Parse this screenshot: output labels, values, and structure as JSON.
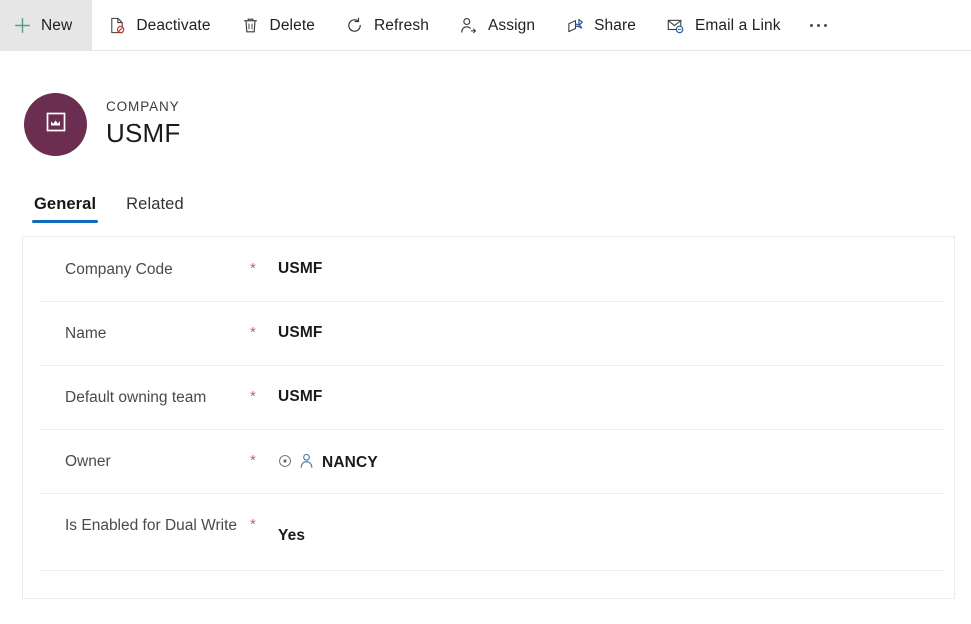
{
  "commandbar": {
    "buttons": [
      {
        "label": "New",
        "icon": "plus-icon",
        "state": "active"
      },
      {
        "label": "Deactivate",
        "icon": "deactivate-icon",
        "state": "default"
      },
      {
        "label": "Delete",
        "icon": "trash-icon",
        "state": "default"
      },
      {
        "label": "Refresh",
        "icon": "refresh-icon",
        "state": "default"
      },
      {
        "label": "Assign",
        "icon": "assign-user-icon",
        "state": "default"
      },
      {
        "label": "Share",
        "icon": "share-icon",
        "state": "default"
      },
      {
        "label": "Email a Link",
        "icon": "email-link-icon",
        "state": "default"
      }
    ],
    "overflow_icon": "ellipsis-icon"
  },
  "record_header": {
    "entity_label": "COMPANY",
    "title": "USMF",
    "avatar_icon": "company-icon",
    "avatar_color": "#6B2E50"
  },
  "tabs": [
    {
      "label": "General",
      "selected": true
    },
    {
      "label": "Related",
      "selected": false
    }
  ],
  "form": {
    "fields": [
      {
        "label": "Company Code",
        "required": "*",
        "value": "USMF"
      },
      {
        "label": "Name",
        "required": "*",
        "value": "USMF"
      },
      {
        "label": "Default owning team",
        "required": "*",
        "value": "USMF"
      },
      {
        "label": "Owner",
        "required": "*",
        "value": "NANCY",
        "icons": [
          "recent-record-icon",
          "person-icon"
        ]
      },
      {
        "label": "Is Enabled for Dual Write",
        "required": "*",
        "value": "Yes"
      }
    ]
  },
  "colors": {
    "tab_underline": "#0F6CBD",
    "required_asterisk": "#C6657A",
    "new_icon": "#5A9E7D",
    "accent_blue": "#2B579A"
  }
}
